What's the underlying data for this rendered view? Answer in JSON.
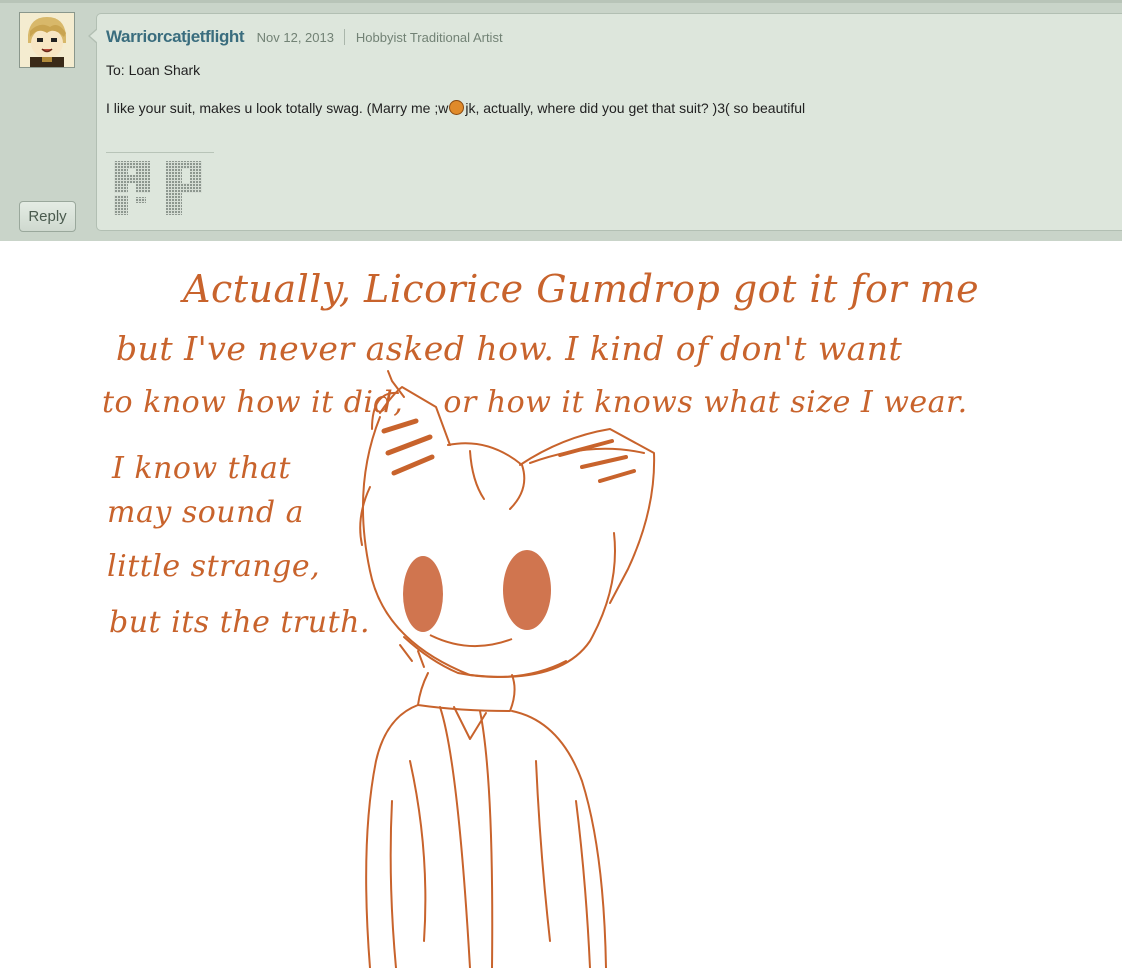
{
  "comment": {
    "username": "Warriorcatjetflight",
    "date": "Nov 12, 2013",
    "deviant_type": "Hobbyist Traditional Artist",
    "to_line": "To: Loan Shark",
    "body_before_emote": "I like your suit, makes u look totally swag. (Marry me ;w",
    "body_after_emote": "jk, actually, where did you get that suit? )3( so beautiful",
    "emote_icon": "orange-smiley-emote-icon",
    "reply_label": "Reply",
    "signature_text": "RP"
  },
  "artwork": {
    "lines": [
      "Actually, Licorice Gumdrop got it for me",
      "but I've never asked how. I kind of don't want",
      "to know how it did,    or how it knows what size I wear.",
      "I know that",
      "may sound a",
      "little strange,",
      "but its the truth."
    ],
    "ink_color": "#c8632c"
  },
  "colors": {
    "panel_bg": "#c9d4c9",
    "bubble_bg": "#dde6dc",
    "username": "#3a6d7e",
    "ink": "#c8632c"
  }
}
